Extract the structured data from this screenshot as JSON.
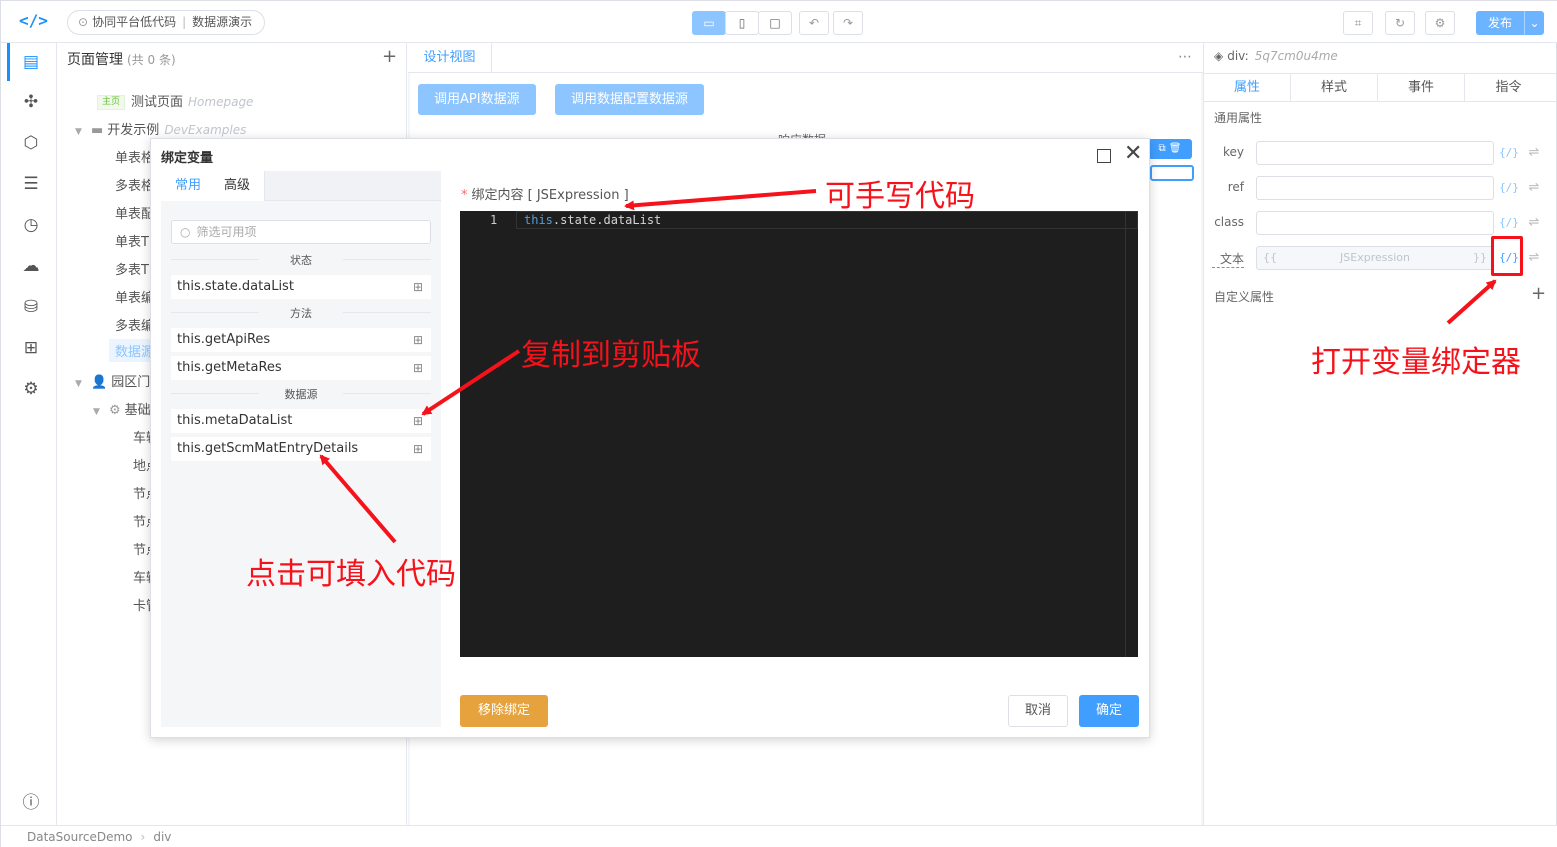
{
  "topbar": {
    "logo_icon": "code-icon",
    "breadcrumb": [
      "协同平台低代码",
      "数据源演示"
    ],
    "devices": [
      "desktop-icon",
      "tablet-icon",
      "mobile-icon"
    ],
    "publish_label": "发布"
  },
  "tree": {
    "title": "页面管理",
    "count": "(共 0 条)",
    "nodes": [
      {
        "tag": "主页",
        "label": "测试页面",
        "en": "Homepage"
      },
      {
        "label": "开发示例",
        "en": "DevExamples"
      },
      {
        "label": "单表格"
      },
      {
        "label": "多表格"
      },
      {
        "label": "单表配"
      },
      {
        "label": "单表T"
      },
      {
        "label": "多表T"
      },
      {
        "label": "单表编"
      },
      {
        "label": "多表编"
      },
      {
        "label": "数据源"
      },
      {
        "label": "园区门"
      },
      {
        "label": "基础"
      },
      {
        "label": "车辆"
      },
      {
        "label": "地点"
      },
      {
        "label": "节点"
      },
      {
        "label": "节点"
      },
      {
        "label": "节点"
      },
      {
        "label": "车辆"
      },
      {
        "label": "卡管"
      }
    ]
  },
  "canvas": {
    "tab": "设计视图",
    "btn_api": "调用API数据源",
    "btn_cfg": "调用数据配置数据源",
    "resp_label": "响应数据"
  },
  "right_panel": {
    "component": "div:",
    "component_id": "5q7cm0u4me",
    "tabs": [
      "属性",
      "样式",
      "事件",
      "指令"
    ],
    "section_common": "通用属性",
    "fields": [
      {
        "label": "key",
        "value": ""
      },
      {
        "label": "ref",
        "value": ""
      },
      {
        "label": "class",
        "value": ""
      },
      {
        "label": "文本",
        "value": "JSExpression"
      }
    ],
    "expr_open": "{{",
    "expr_close": "}}",
    "bind_icon": "{/}",
    "section_custom": "自定义属性"
  },
  "status": {
    "path": [
      "DataSourceDemo",
      "div"
    ]
  },
  "dialog": {
    "title": "绑定变量",
    "tabs": [
      "常用",
      "高级"
    ],
    "filter_placeholder": "筛选可用项",
    "group_state": "状态",
    "group_method": "方法",
    "group_datasource": "数据源",
    "state_items": [
      "this.state.dataList"
    ],
    "method_items": [
      "this.getApiRes",
      "this.getMetaRes"
    ],
    "datasource_items": [
      "this.metaDataList",
      "this.getScmMatEntryDetails"
    ],
    "content_label": "绑定内容 [ JSExpression ]",
    "code_line_no": "1",
    "code_kw": "this",
    "code_rest": ".state.dataList",
    "btn_unbind": "移除绑定",
    "btn_cancel": "取消",
    "btn_ok": "确定"
  },
  "annotations": {
    "handwrite": "可手写代码",
    "copy": "复制到剪贴板",
    "click_fill": "点击可填入代码",
    "open_binder": "打开变量绑定器",
    "color": "#f5121a"
  }
}
